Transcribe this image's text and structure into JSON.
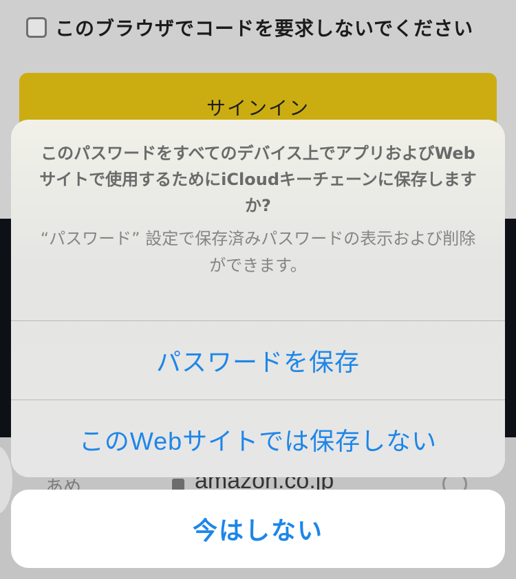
{
  "background": {
    "checkbox_label": "このブラウザでコードを要求しないでください",
    "signin_label": "サインイン",
    "keyboard_hint": "あめ",
    "url": "amazon.co.jp"
  },
  "sheet": {
    "title": "このパスワードをすべてのデバイス上でアプリおよびWebサイトで使用するためにiCloudキーチェーンに保存しますか?",
    "message": "“パスワード” 設定で保存済みパスワードの表示および削除ができます。",
    "actions": [
      {
        "label": "パスワードを保存"
      },
      {
        "label": "このWebサイトでは保存しない"
      }
    ],
    "cancel_label": "今はしない"
  },
  "colors": {
    "accent": "#1d86e8",
    "signin_button": "#cbad12"
  }
}
